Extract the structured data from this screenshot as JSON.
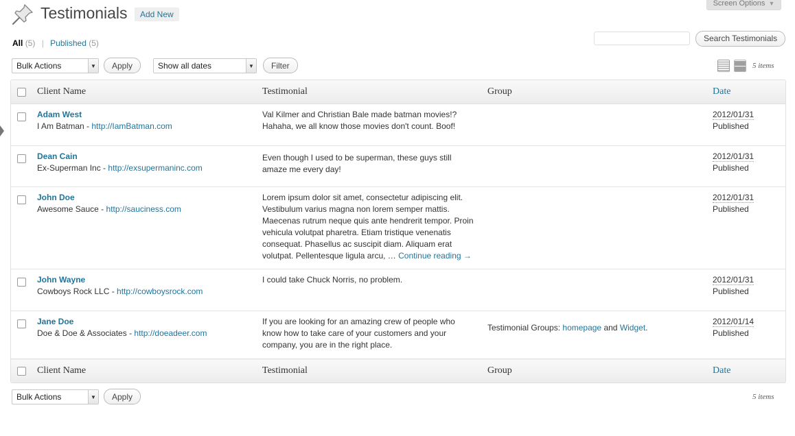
{
  "header": {
    "title": "Testimonials",
    "add_new": "Add New",
    "screen_options": "Screen Options"
  },
  "filters": {
    "all_label": "All",
    "all_count": "(5)",
    "published_label": "Published",
    "published_count": "(5)"
  },
  "search": {
    "value": "",
    "button": "Search Testimonials"
  },
  "toolbar": {
    "bulk_actions": "Bulk Actions",
    "apply": "Apply",
    "dates": "Show all dates",
    "filter": "Filter",
    "items_count": "5 items"
  },
  "table": {
    "columns": [
      "Client Name",
      "Testimonial",
      "Group",
      "Date"
    ],
    "rows": [
      {
        "name": "Adam West",
        "company": "I Am Batman",
        "url": "http://IamBatman.com",
        "testimonial": "Val Kilmer and Christian Bale made batman movies!? Hahaha, we all know those movies don't count.  Boof!",
        "group_prefix": "",
        "group_link1": "",
        "group_and": "",
        "group_link2": "",
        "group_end": "",
        "date": "2012/01/31",
        "status": "Published"
      },
      {
        "name": "Dean Cain",
        "company": "Ex-Superman Inc",
        "url": "http://exsupermaninc.com",
        "testimonial": "Even though I used to be superman, these guys still amaze me every day!",
        "group_prefix": "",
        "group_link1": "",
        "group_and": "",
        "group_link2": "",
        "group_end": "",
        "date": "2012/01/31",
        "status": "Published"
      },
      {
        "name": "John Doe",
        "company": "Awesome Sauce",
        "url": "http://sauciness.com",
        "testimonial": "Lorem ipsum dolor sit amet, consectetur adipiscing elit. Vestibulum varius magna non lorem semper mattis. Maecenas rutrum neque quis ante hendrerit tempor. Proin vehicula volutpat pharetra. Etiam tristique venenatis consequat. Phasellus ac suscipit diam. Aliquam erat volutpat. Pellentesque ligula arcu, …",
        "continue": "Continue reading →",
        "group_prefix": "",
        "group_link1": "",
        "group_and": "",
        "group_link2": "",
        "group_end": "",
        "date": "2012/01/31",
        "status": "Published"
      },
      {
        "name": "John Wayne",
        "company": "Cowboys Rock LLC",
        "url": "http://cowboysrock.com",
        "testimonial": "I could take Chuck Norris, no problem.",
        "group_prefix": "",
        "group_link1": "",
        "group_and": "",
        "group_link2": "",
        "group_end": "",
        "date": "2012/01/31",
        "status": "Published"
      },
      {
        "name": "Jane Doe",
        "company": "Doe & Doe & Associates",
        "url": "http://doeadeer.com",
        "testimonial": "If you are looking for an amazing crew of people who know how to take care of your customers and your company, you are in the right place.",
        "group_prefix": "Testimonial Groups: ",
        "group_link1": "homepage",
        "group_and": " and ",
        "group_link2": "Widget",
        "group_end": ".",
        "date": "2012/01/14",
        "status": "Published"
      }
    ]
  },
  "colors": {
    "link": "#21759b",
    "header_bg": "#ececec",
    "border": "#dfdfdf"
  }
}
